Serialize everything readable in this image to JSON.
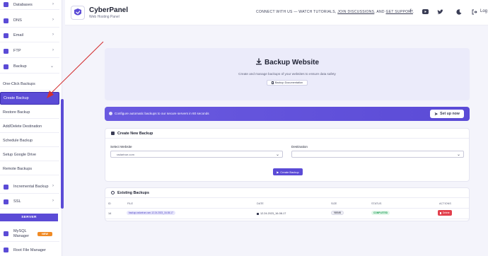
{
  "sidebar": {
    "items": [
      {
        "label": "Databases",
        "icon": "database-icon"
      },
      {
        "label": "DNS",
        "icon": "dns-icon"
      },
      {
        "label": "Email",
        "icon": "email-icon"
      },
      {
        "label": "FTP",
        "icon": "folder-icon"
      },
      {
        "label": "Backup",
        "icon": "backup-icon"
      }
    ],
    "backup_sub": [
      "One-Click Backups",
      "Create Backup",
      "Restore Backup",
      "Add/Delete Destination",
      "Schedule Backup",
      "Setup Google Drive",
      "Remote Backups"
    ],
    "incremental": "Incremental Backup",
    "ssl": "SSL",
    "server_section": "SERVER",
    "mysql_line1": "MySQL",
    "mysql_line2": "Manager",
    "new_badge": "NEW",
    "root_file_manager": "Root File Manager"
  },
  "header": {
    "brand": "CyberPanel",
    "brand_sub": "Web Hosting Panel",
    "connect_prefix": "CONNECT WITH US — WATCH TUTORIALS, ",
    "connect_link1": "JOIN DISCUSSIONS",
    "connect_mid": ", AND ",
    "connect_link2": "GET SUPPORT",
    "connect_suffix": ".",
    "logout": "Log"
  },
  "hero": {
    "title": "Backup Website",
    "subtitle": "Create and manage backups of your websites to ensure data safety",
    "doc_button": "Backup Documentation"
  },
  "promo": {
    "text": "Configure automatic backups to our secure servers in 60 seconds",
    "button": "Set up now"
  },
  "create": {
    "heading": "Create New Backup",
    "website_label": "Select Website",
    "website_value": "radartrue.com",
    "destination_label": "Destination",
    "destination_value": "",
    "button": "Create Backup"
  },
  "existing": {
    "heading": "Existing Backups",
    "columns": [
      "ID",
      "FILE",
      "DATE",
      "SIZE",
      "STATUS",
      "ACTIONS"
    ],
    "row": {
      "id": "14",
      "file": "backup-radartrue.com-12.24.2023_16-08-17",
      "date": "12.24.2023_16-08-17",
      "size": "969MB",
      "status": "COMPLETED",
      "action": "Delete"
    }
  },
  "colors": {
    "accent": "#5b4bd6",
    "danger": "#e2404d",
    "success": "#1f9d55",
    "annotation": "#d32f2f"
  }
}
